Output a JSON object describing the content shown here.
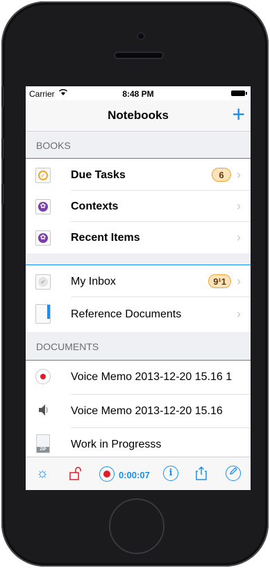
{
  "status": {
    "carrier": "Carrier",
    "time": "8:48 PM"
  },
  "navbar": {
    "title": "Notebooks",
    "add_label": "+"
  },
  "sections": {
    "books": "BOOKS",
    "documents": "DOCUMENTS"
  },
  "books": [
    {
      "label": "Due Tasks",
      "badge": "6",
      "icon": "due-tasks-icon"
    },
    {
      "label": "Contexts",
      "icon": "contexts-icon"
    },
    {
      "label": "Recent Items",
      "icon": "recent-items-icon"
    }
  ],
  "lists": [
    {
      "label": "My Inbox",
      "badge": "9¹1",
      "icon": "inbox-icon"
    },
    {
      "label": "Reference Documents",
      "icon": "reference-documents-icon"
    }
  ],
  "documents": [
    {
      "label": "Voice Memo 2013-12-20 15.16 1",
      "icon": "voice-memo-record-icon"
    },
    {
      "label": "Voice Memo 2013-12-20 15.16",
      "icon": "audio-file-icon"
    },
    {
      "label": "Work in Progresss",
      "icon": "zip-file-icon",
      "icon_text": "ZIP"
    }
  ],
  "toolbar": {
    "timer": "0:00:07"
  },
  "colors": {
    "accent": "#1a8ff0",
    "record": "#e21b28",
    "badge": "#fde3b8"
  }
}
